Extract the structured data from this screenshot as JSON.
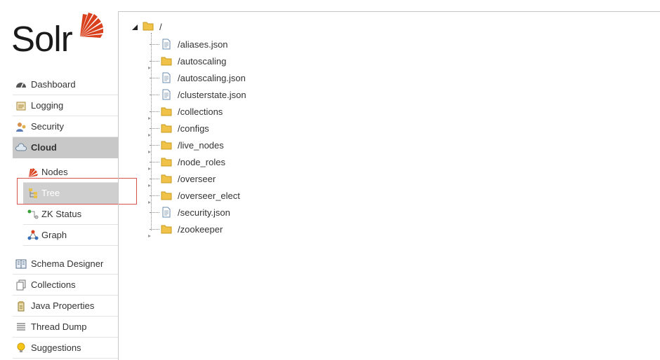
{
  "brand": {
    "wordmark": "Solr",
    "accent": "#d9411e"
  },
  "nav": {
    "items": [
      {
        "id": "dashboard",
        "label": "Dashboard",
        "icon": "dashboard-icon"
      },
      {
        "id": "logging",
        "label": "Logging",
        "icon": "logging-icon"
      },
      {
        "id": "security",
        "label": "Security",
        "icon": "security-icon"
      },
      {
        "id": "cloud",
        "label": "Cloud",
        "icon": "cloud-icon",
        "active": true
      }
    ],
    "cloud_sub": [
      {
        "id": "nodes",
        "label": "Nodes",
        "icon": "nodes-icon"
      },
      {
        "id": "tree",
        "label": "Tree",
        "icon": "tree-icon",
        "active": true
      },
      {
        "id": "zk-status",
        "label": "ZK Status",
        "icon": "zk-status-icon"
      },
      {
        "id": "graph",
        "label": "Graph",
        "icon": "graph-icon"
      }
    ],
    "lower": [
      {
        "id": "schema-designer",
        "label": "Schema Designer",
        "icon": "schema-designer-icon"
      },
      {
        "id": "collections",
        "label": "Collections",
        "icon": "collections-icon"
      },
      {
        "id": "java-properties",
        "label": "Java Properties",
        "icon": "java-properties-icon"
      },
      {
        "id": "thread-dump",
        "label": "Thread Dump",
        "icon": "thread-dump-icon"
      },
      {
        "id": "suggestions",
        "label": "Suggestions",
        "icon": "suggestions-icon"
      }
    ]
  },
  "tree": {
    "root": {
      "label": "/",
      "type": "folder"
    },
    "children": [
      {
        "label": "/aliases.json",
        "type": "file"
      },
      {
        "label": "/autoscaling",
        "type": "folder"
      },
      {
        "label": "/autoscaling.json",
        "type": "file"
      },
      {
        "label": "/clusterstate.json",
        "type": "file"
      },
      {
        "label": "/collections",
        "type": "folder"
      },
      {
        "label": "/configs",
        "type": "folder"
      },
      {
        "label": "/live_nodes",
        "type": "folder"
      },
      {
        "label": "/node_roles",
        "type": "folder"
      },
      {
        "label": "/overseer",
        "type": "folder"
      },
      {
        "label": "/overseer_elect",
        "type": "folder"
      },
      {
        "label": "/security.json",
        "type": "file"
      },
      {
        "label": "/zookeeper",
        "type": "folder"
      }
    ]
  }
}
